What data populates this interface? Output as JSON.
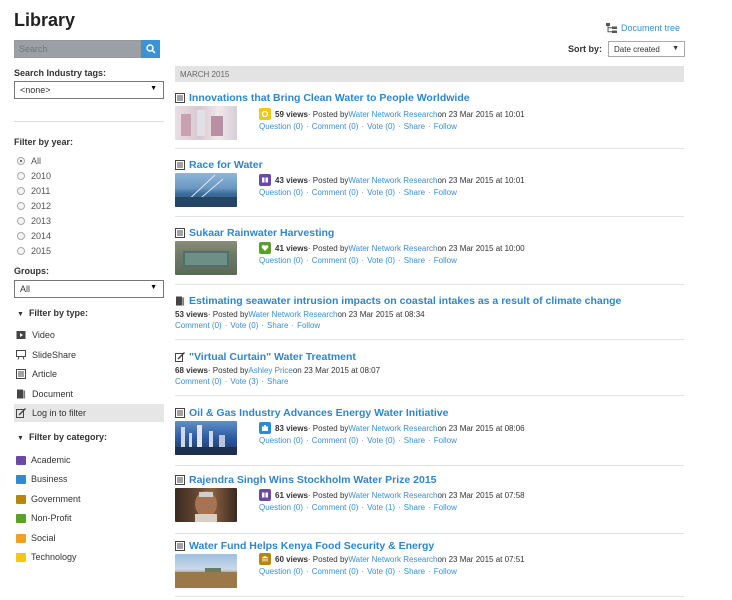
{
  "page": {
    "title": "Library"
  },
  "search": {
    "placeholder": "Search"
  },
  "industry_tags": {
    "label": "Search Industry tags:",
    "value": "<none>"
  },
  "year_filter": {
    "label": "Filter by year:",
    "options": [
      "All",
      "2010",
      "2011",
      "2012",
      "2013",
      "2014",
      "2015"
    ],
    "selected": "All"
  },
  "groups": {
    "label": "Groups:",
    "value": "All"
  },
  "type_filter": {
    "label": "Filter by type:",
    "items": [
      "Video",
      "SlideShare",
      "Article",
      "Document",
      "Log in to filter"
    ]
  },
  "category_filter": {
    "label": "Filter by category:",
    "items": [
      {
        "label": "Academic",
        "color": "#6b4aa6"
      },
      {
        "label": "Business",
        "color": "#2e8bd6"
      },
      {
        "label": "Government",
        "color": "#b8860b"
      },
      {
        "label": "Non-Profit",
        "color": "#5aa02c"
      },
      {
        "label": "Social",
        "color": "#f0a020"
      },
      {
        "label": "Technology",
        "color": "#f2c811"
      }
    ]
  },
  "header": {
    "document_tree": "Document tree",
    "sort_label": "Sort by:",
    "sort_value": "Date created"
  },
  "month": "MARCH 2015",
  "items": [
    {
      "title": "Innovations that Bring Clean Water to People Worldwide",
      "views": "59 views",
      "byline": " · Posted by ",
      "author": "Water Network Research",
      "date": " on 23 Mar 2015 at 10:01",
      "actions": [
        "Question (0)",
        "Comment (0)",
        "Vote (0)",
        "Share",
        "Follow"
      ]
    },
    {
      "title": "Race for Water",
      "views": "43 views",
      "byline": " · Posted by ",
      "author": "Water Network Research",
      "date": " on 23 Mar 2015 at 10:01",
      "actions": [
        "Question (0)",
        "Comment (0)",
        "Vote (0)",
        "Share",
        "Follow"
      ]
    },
    {
      "title": "Sukaar Rainwater Harvesting",
      "views": "41 views",
      "byline": " · Posted by ",
      "author": "Water Network Research",
      "date": " on 23 Mar 2015 at 10:00",
      "actions": [
        "Question (0)",
        "Comment (0)",
        "Vote (0)",
        "Share",
        "Follow"
      ]
    },
    {
      "title": "Estimating seawater intrusion impacts on coastal intakes as a result of climate change",
      "views": "53 views",
      "byline": " · Posted by ",
      "author": "Water Network Research",
      "date": " on 23 Mar 2015 at 08:34",
      "actions": [
        "Comment (0)",
        "Vote (0)",
        "Share",
        "Follow"
      ]
    },
    {
      "title": "\"Virtual Curtain\" Water Treatment",
      "views": "68 views",
      "byline": " · Posted by ",
      "author": "Ashley Price",
      "date": " on 23 Mar 2015 at 08:07",
      "actions": [
        "Comment (0)",
        "Vote (3)",
        "Share"
      ]
    },
    {
      "title": "Oil & Gas Industry Advances Energy Water Initiative",
      "views": "83 views",
      "byline": " · Posted by ",
      "author": "Water Network Research",
      "date": " on 23 Mar 2015 at 08:06",
      "actions": [
        "Question (0)",
        "Comment (0)",
        "Vote (0)",
        "Share",
        "Follow"
      ]
    },
    {
      "title": "Rajendra Singh Wins Stockholm Water Prize 2015",
      "views": "61 views",
      "byline": " · Posted by ",
      "author": "Water Network Research",
      "date": " on 23 Mar 2015 at 07:58",
      "actions": [
        "Question (0)",
        "Comment (0)",
        "Vote (1)",
        "Share",
        "Follow"
      ]
    },
    {
      "title": "Water Fund Helps Kenya Food Security & Energy",
      "views": "60 views",
      "byline": " · Posted by ",
      "author": "Water Network Research",
      "date": " on 23 Mar 2015 at 07:51",
      "actions": [
        "Question (0)",
        "Comment (0)",
        "Vote (0)",
        "Share",
        "Follow"
      ]
    }
  ]
}
